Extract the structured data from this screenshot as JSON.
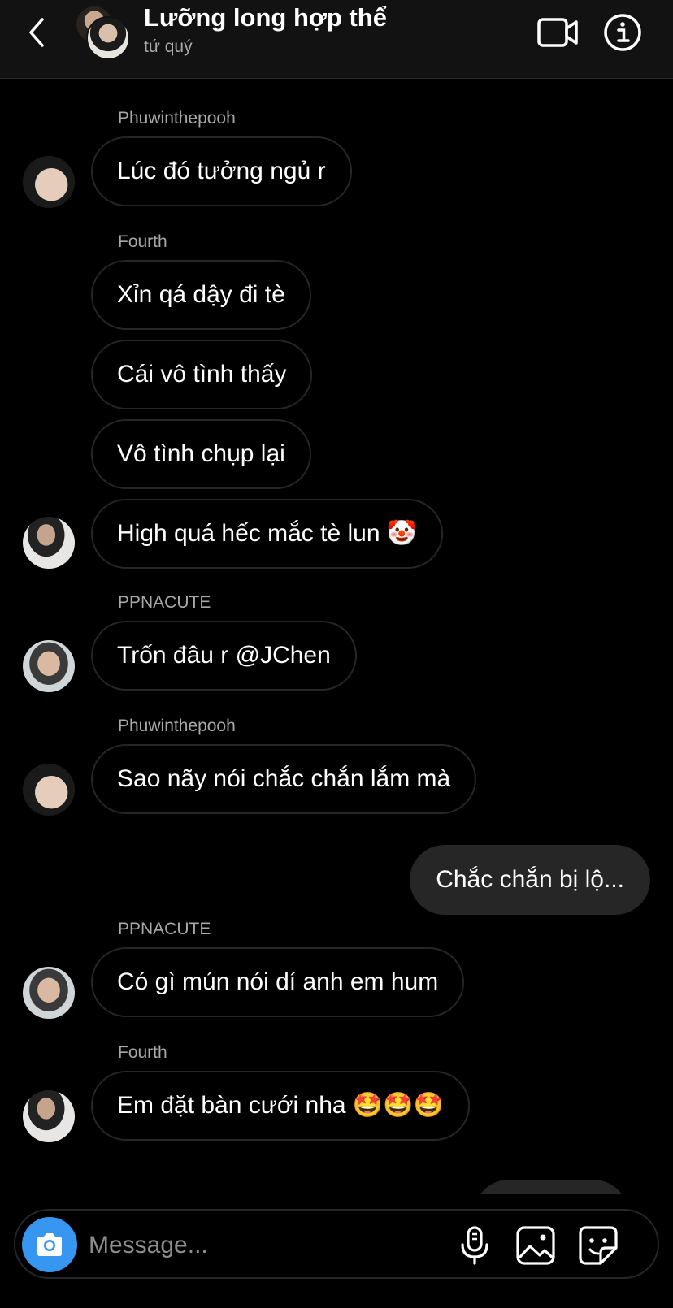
{
  "header": {
    "title": "Lưỡng long hợp thể",
    "subtitle": "tứ quý"
  },
  "messages": [
    {
      "sender": "Phuwinthepooh",
      "texts": [
        "Lúc đó tưởng ngủ r"
      ]
    },
    {
      "sender": "Fourth",
      "texts": [
        "Xỉn qá dậy đi tè",
        "Cái vô tình thấy",
        "Vô tình chụp lại",
        "High quá hếc mắc tè lun 🤡"
      ]
    },
    {
      "sender": "PPNACUTE",
      "texts": [
        "Trốn đâu r @JChen"
      ]
    },
    {
      "sender": "Phuwinthepooh",
      "texts": [
        "Sao nãy nói chắc chắn lắm mà"
      ]
    },
    {
      "outgoing": true,
      "texts": [
        "Chắc chắn bị lộ..."
      ]
    },
    {
      "sender": "PPNACUTE",
      "texts": [
        "Có gì mún nói dí anh em hum"
      ]
    },
    {
      "sender": "Fourth",
      "texts": [
        "Em đặt bàn cưới nha 🤩🤩🤩"
      ]
    }
  ],
  "composer": {
    "placeholder": "Message..."
  },
  "icons": {
    "back": "chevron-left-icon",
    "video": "video-camera-icon",
    "info": "info-icon",
    "camera": "camera-icon",
    "mic": "microphone-icon",
    "gallery": "gallery-icon",
    "sticker": "sticker-icon"
  },
  "colors": {
    "background": "#000000",
    "header": "#121212",
    "outgoing_bubble": "#262626",
    "accent": "#3797f0",
    "secondary_text": "#a8a8a8"
  }
}
